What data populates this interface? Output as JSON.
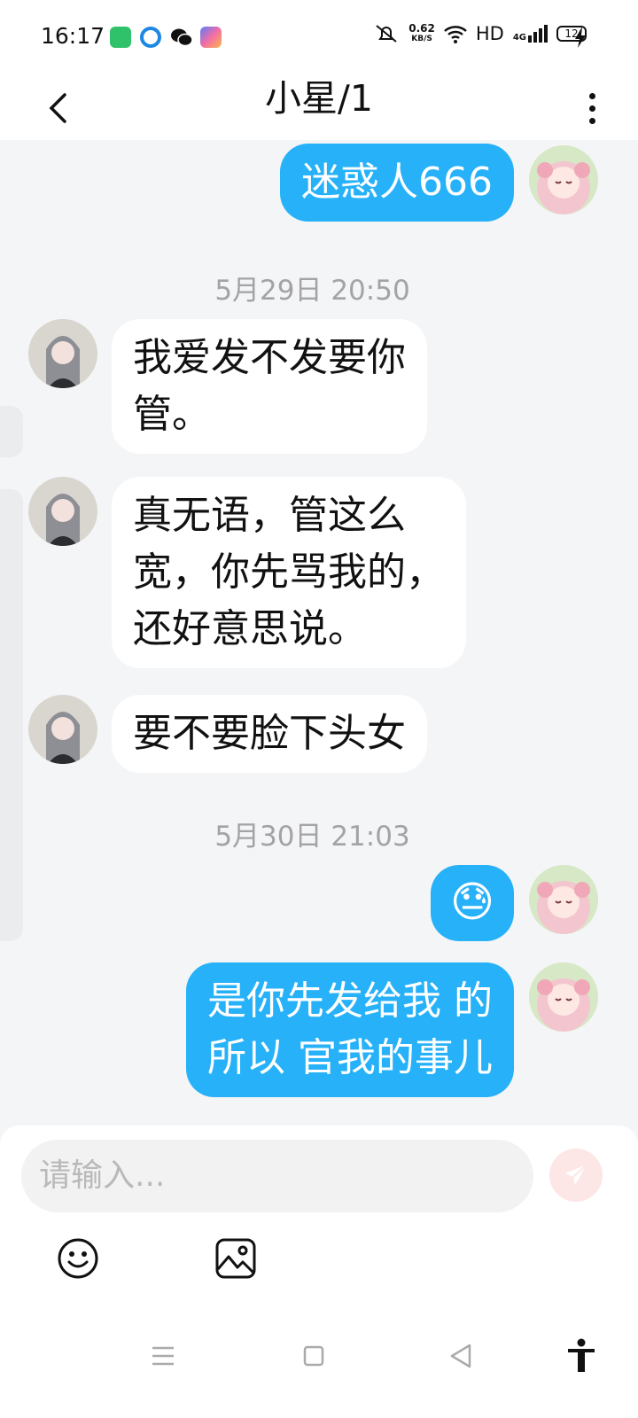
{
  "status_bar": {
    "time": "16:17",
    "net_speed_value": "0.62",
    "net_speed_unit": "KB/S",
    "network_label": "HD",
    "signal_label": "4G",
    "battery_level": "12",
    "app_icons": [
      "app-store-icon",
      "browser-icon",
      "wechat-icon",
      "gallery-icon"
    ]
  },
  "header": {
    "title": "小星/1"
  },
  "messages": [
    {
      "side": "out",
      "text": "迷惑人666"
    },
    {
      "type": "timestamp",
      "text": "5月29日 20:50"
    },
    {
      "side": "in",
      "text": "我爱发不发要你\n管。"
    },
    {
      "side": "in",
      "text": "真无语，管这么\n宽，你先骂我的，\n还好意思说。"
    },
    {
      "side": "in",
      "text": "要不要脸下头女"
    },
    {
      "type": "timestamp",
      "text": "5月30日 21:03"
    },
    {
      "side": "out",
      "text": "😓"
    },
    {
      "side": "out",
      "text": "是你先发给我 的\n所以 官我的事儿"
    }
  ],
  "input": {
    "placeholder": "请输入..."
  },
  "colors": {
    "outgoing_bubble": "#26b1f8",
    "incoming_bubble": "#ffffff",
    "send_button": "#fde6e6"
  }
}
